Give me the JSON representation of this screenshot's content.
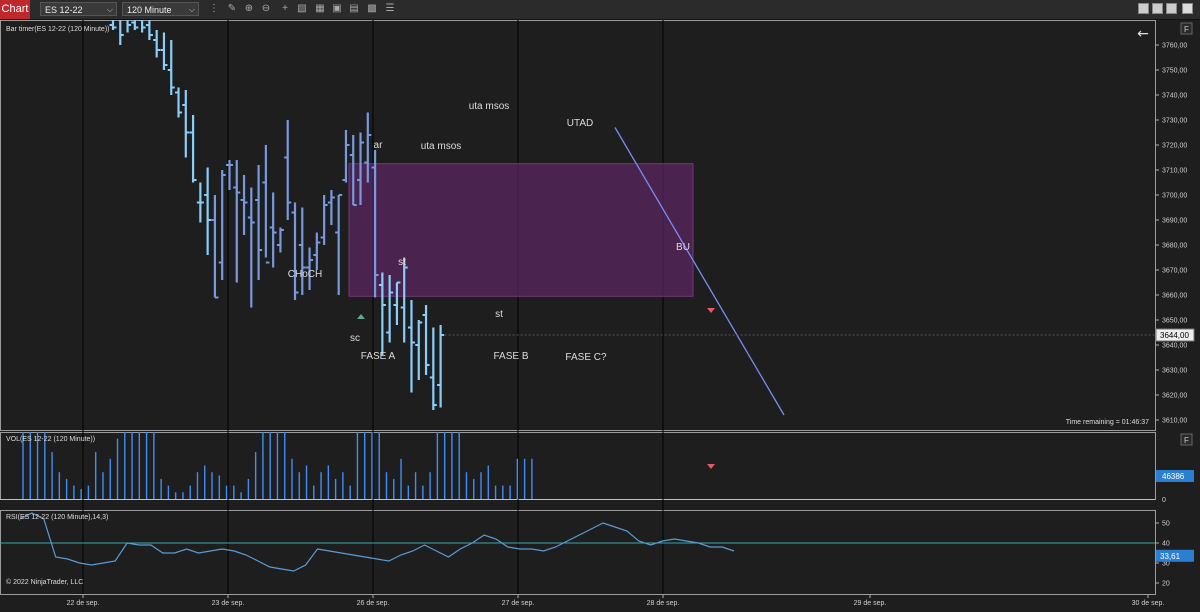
{
  "toolbar": {
    "chart_tab": "Chart",
    "instrument": "ES 12-22",
    "timeframe": "120 Minute"
  },
  "panels": {
    "price_title": "Bar timer(ES 12-22 (120 Minute))",
    "volume_title": "VOL(ES 12-22 (120 Minute))",
    "rsi_title": "RSI(ES 12-22 (120 Minute),14,3)",
    "copyright": "© 2022 NinjaTrader, LLC",
    "time_remaining": "Time remaining = 01:46:37",
    "panel_button": "F",
    "back_arrow": "←"
  },
  "colors": {
    "background": "#1e1e1e",
    "bar_up": "#87cefa",
    "bar_range": "#7799dd",
    "range_box": "#5a2560",
    "trendline": "#7a8ef0",
    "rsi_line": "#5b9bd5",
    "rsi_level": "#3aa6a6",
    "volume": "#3e8ef7",
    "price_tag": "#2a7fd0"
  },
  "chart_data": [
    {
      "type": "bar",
      "name": "price",
      "x_labels": [
        "22 de sep.",
        "23 de sep.",
        "26 de sep.",
        "27 de sep.",
        "28 de sep.",
        "29 de sep.",
        "30 de sep."
      ],
      "ylim": [
        3608,
        3770
      ],
      "y_ticks": [
        "3760,00",
        "3750,00",
        "3740,00",
        "3730,00",
        "3720,00",
        "3710,00",
        "3700,00",
        "3690,00",
        "3680,00",
        "3670,00",
        "3660,00",
        "3650,00",
        "3640,00",
        "3630,00",
        "3620,00",
        "3610,00"
      ],
      "last_price": "3644,00",
      "annotations": [
        "ar",
        "uta msos",
        "uta msos",
        "UTAD",
        "CHoCH",
        "st",
        "st",
        "BU",
        "sc",
        "FASE A",
        "FASE B",
        "FASE C?"
      ],
      "bars": [
        {
          "h": 3770,
          "l": 3766,
          "o": 3768,
          "c": 3767
        },
        {
          "h": 3780,
          "l": 3760,
          "o": 3775,
          "c": 3764
        },
        {
          "h": 3785,
          "l": 3765,
          "o": 3772,
          "c": 3768
        },
        {
          "h": 3770,
          "l": 3766,
          "o": 3769,
          "c": 3767
        },
        {
          "h": 3785,
          "l": 3765,
          "o": 3770,
          "c": 3767
        },
        {
          "h": 3770,
          "l": 3762,
          "o": 3768,
          "c": 3764
        },
        {
          "h": 3766,
          "l": 3755,
          "o": 3762,
          "c": 3758
        },
        {
          "h": 3765,
          "l": 3750,
          "o": 3758,
          "c": 3752
        },
        {
          "h": 3762,
          "l": 3740,
          "o": 3750,
          "c": 3743
        },
        {
          "h": 3743,
          "l": 3731,
          "o": 3741,
          "c": 3733
        },
        {
          "h": 3742,
          "l": 3715,
          "o": 3736,
          "c": 3725
        },
        {
          "h": 3732,
          "l": 3705,
          "o": 3725,
          "c": 3706
        },
        {
          "h": 3705,
          "l": 3689,
          "o": 3697,
          "c": 3697
        },
        {
          "h": 3711,
          "l": 3676,
          "o": 3700,
          "c": 3690
        },
        {
          "h": 3700,
          "l": 3659,
          "o": 3690,
          "c": 3659
        },
        {
          "h": 3710,
          "l": 3666,
          "o": 3673,
          "c": 3708
        },
        {
          "h": 3714,
          "l": 3702,
          "o": 3712,
          "c": 3712
        },
        {
          "h": 3714,
          "l": 3665,
          "o": 3703,
          "c": 3701
        },
        {
          "h": 3708,
          "l": 3684,
          "o": 3698,
          "c": 3697
        },
        {
          "h": 3703,
          "l": 3655,
          "o": 3691,
          "c": 3689
        },
        {
          "h": 3712,
          "l": 3666,
          "o": 3698,
          "c": 3678
        },
        {
          "h": 3720,
          "l": 3675,
          "o": 3705,
          "c": 3673
        },
        {
          "h": 3701,
          "l": 3671,
          "o": 3687,
          "c": 3685
        },
        {
          "h": 3687,
          "l": 3677,
          "o": 3680,
          "c": 3686
        },
        {
          "h": 3730,
          "l": 3690,
          "o": 3715,
          "c": 3697
        },
        {
          "h": 3697,
          "l": 3658,
          "o": 3693,
          "c": 3661
        },
        {
          "h": 3695,
          "l": 3660,
          "o": 3680,
          "c": 3671
        },
        {
          "h": 3679,
          "l": 3662,
          "o": 3671,
          "c": 3674
        },
        {
          "h": 3685,
          "l": 3670,
          "o": 3676,
          "c": 3681
        },
        {
          "h": 3700,
          "l": 3680,
          "o": 3683,
          "c": 3696
        },
        {
          "h": 3702,
          "l": 3688,
          "o": 3697,
          "c": 3699
        },
        {
          "h": 3700,
          "l": 3660,
          "o": 3685,
          "c": 3700
        },
        {
          "h": 3726,
          "l": 3705,
          "o": 3706,
          "c": 3720
        },
        {
          "h": 3724,
          "l": 3696,
          "o": 3716,
          "c": 3696
        },
        {
          "h": 3725,
          "l": 3696,
          "o": 3706,
          "c": 3721
        },
        {
          "h": 3733,
          "l": 3705,
          "o": 3713,
          "c": 3724
        },
        {
          "h": 3718,
          "l": 3659,
          "o": 3711,
          "c": 3668
        },
        {
          "h": 3669,
          "l": 3636,
          "o": 3664,
          "c": 3656
        },
        {
          "h": 3668,
          "l": 3641,
          "o": 3645,
          "c": 3661
        },
        {
          "h": 3665,
          "l": 3648,
          "o": 3656,
          "c": 3665
        },
        {
          "h": 3675,
          "l": 3641,
          "o": 3655,
          "c": 3671
        },
        {
          "h": 3658,
          "l": 3621,
          "o": 3647,
          "c": 3641
        },
        {
          "h": 3650,
          "l": 3626,
          "o": 3640,
          "c": 3649
        },
        {
          "h": 3656,
          "l": 3628,
          "o": 3652,
          "c": 3632
        },
        {
          "h": 3647,
          "l": 3614,
          "o": 3627,
          "c": 3616
        },
        {
          "h": 3648,
          "l": 3615,
          "o": 3624,
          "c": 3644
        }
      ]
    },
    {
      "type": "bar",
      "name": "volume",
      "y_ticks": [
        "0"
      ],
      "last_value": "46386",
      "values": [
        100,
        100,
        100,
        100,
        70,
        40,
        30,
        20,
        15,
        20,
        70,
        40,
        60,
        90,
        100,
        100,
        100,
        100,
        100,
        30,
        20,
        10,
        10,
        20,
        40,
        50,
        40,
        35,
        20,
        20,
        10,
        30,
        70,
        100,
        100,
        100,
        100,
        60,
        40,
        50,
        20,
        40,
        50,
        30,
        40,
        20,
        100,
        100,
        100,
        100,
        40,
        30,
        60,
        20,
        40,
        20,
        40,
        100,
        100,
        100,
        100,
        40,
        30,
        40,
        50,
        20,
        20,
        20,
        60,
        60,
        60
      ]
    },
    {
      "type": "line",
      "name": "rsi",
      "ylim": [
        18,
        56
      ],
      "y_ticks": [
        "50",
        "40",
        "30",
        "20"
      ],
      "levels": [
        40
      ],
      "last_value": "33,61",
      "values": [
        52,
        55,
        52,
        33,
        32,
        30,
        29,
        30,
        31,
        40,
        39,
        39,
        35,
        35,
        37,
        35,
        36,
        37,
        36,
        34,
        31,
        28,
        27,
        26,
        29,
        37,
        36,
        35,
        34,
        33,
        32,
        31,
        34,
        36,
        39,
        36,
        33,
        37,
        40,
        44,
        42,
        38,
        37,
        37,
        36,
        38,
        41,
        44,
        47,
        50,
        48,
        46,
        41,
        39,
        41,
        42,
        41,
        40,
        38,
        38,
        36
      ]
    }
  ]
}
